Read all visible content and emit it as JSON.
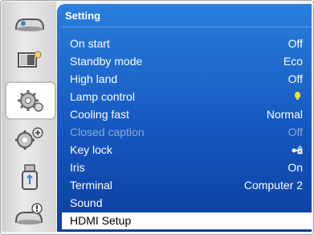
{
  "panel": {
    "title": "Setting"
  },
  "sidebar": {
    "items": [
      {
        "icon": "display-icon"
      },
      {
        "icon": "picture-adjust-icon"
      },
      {
        "icon": "setting-gear-icon",
        "selected": true
      },
      {
        "icon": "expanded-gears-icon"
      },
      {
        "icon": "usb-memory-icon"
      },
      {
        "icon": "info-icon"
      }
    ]
  },
  "menu": {
    "rows": [
      {
        "label": "On start",
        "value": "Off"
      },
      {
        "label": "Standby mode",
        "value": "Eco"
      },
      {
        "label": "High land",
        "value": "Off"
      },
      {
        "label": "Lamp control",
        "value": "",
        "icon": "lamp-bulb-icon"
      },
      {
        "label": "Cooling fast",
        "value": "Normal"
      },
      {
        "label": "Closed caption",
        "value": "Off",
        "disabled": true
      },
      {
        "label": "Key lock",
        "value": "",
        "icon": "key-lock-icon"
      },
      {
        "label": "Iris",
        "value": "On"
      },
      {
        "label": "Terminal",
        "value": "Computer 2"
      },
      {
        "label": "Sound",
        "value": ""
      },
      {
        "label": "HDMI Setup",
        "value": "",
        "selected": true
      }
    ]
  },
  "colors": {
    "panel_top": "#2a7fdc",
    "panel_bottom": "#0d3f9e",
    "selected_row": "#ffffff",
    "disabled_text": "#8fa6cf",
    "lamp": "#f2e51a"
  }
}
